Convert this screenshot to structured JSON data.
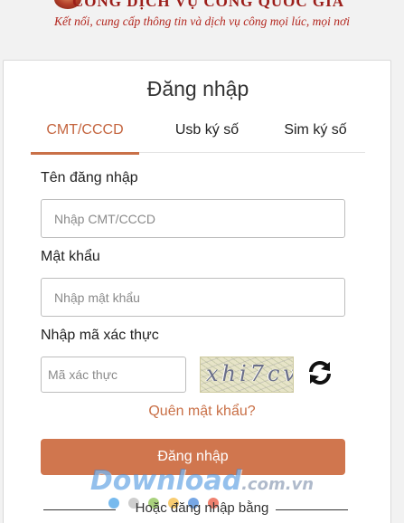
{
  "header": {
    "title_fragment": "CỔNG DỊCH VỤ CÔNG QUỐC GIA",
    "subtitle": "Kết nối, cung cấp thông tin và dịch vụ công mọi lúc, mọi nơi"
  },
  "login": {
    "title": "Đăng nhập",
    "tabs": [
      {
        "label": "CMT/CCCD",
        "active": true
      },
      {
        "label": "Usb ký số",
        "active": false
      },
      {
        "label": "Sim ký số",
        "active": false
      }
    ],
    "username_label": "Tên đăng nhập",
    "username_placeholder": "Nhập CMT/CCCD",
    "password_label": "Mật khẩu",
    "password_placeholder": "Nhập mật khẩu",
    "captcha_label": "Nhập mã xác thực",
    "captcha_placeholder": "Mã xác thực",
    "captcha_text": "xhi7cv",
    "forgot_password": "Quên mật khẩu?",
    "submit_label": "Đăng nhập",
    "alt_login_text": "Hoặc đăng nhập bằng"
  },
  "watermark": {
    "brand": "Download",
    "tld": ".com.vn"
  },
  "colors": {
    "accent": "#d0764e",
    "header_red": "#9b1d19"
  },
  "icons": {
    "refresh": "refresh-icon"
  }
}
